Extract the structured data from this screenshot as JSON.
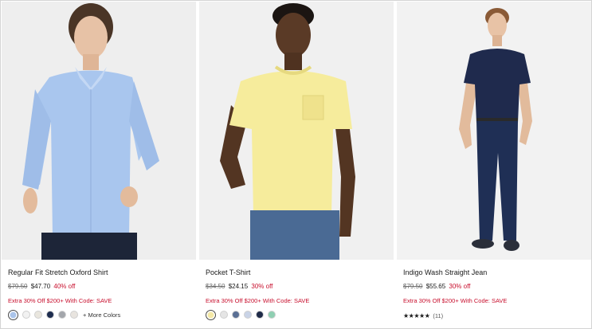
{
  "products": [
    {
      "name": "Regular Fit Stretch Oxford Shirt",
      "original_price": "$79.50",
      "sale_price": "$47.70",
      "discount": "40% off",
      "promo": "Extra 30% Off $200+ With Code: SAVE",
      "swatches": [
        "#aac4ea",
        "#f2f2f2",
        "#e9e6de",
        "#1e2d4f",
        "#a3a6ab",
        "#e8e4df"
      ],
      "more_colors": "+ More Colors"
    },
    {
      "name": "Pocket T-Shirt",
      "original_price": "$34.50",
      "sale_price": "$24.15",
      "discount": "30% off",
      "promo": "Extra 30% Off $200+ With Code: SAVE",
      "swatches": [
        "#f4e8a6",
        "#e5e5e5",
        "#5a6f94",
        "#c9d3e6",
        "#1f2b48",
        "#8fcfb2"
      ]
    },
    {
      "name": "Indigo Wash Straight Jean",
      "original_price": "$79.50",
      "sale_price": "$55.65",
      "discount": "30% off",
      "promo": "Extra 30% Off $200+ With Code: SAVE",
      "stars": "★★★★★",
      "review_count": "(11)"
    }
  ]
}
